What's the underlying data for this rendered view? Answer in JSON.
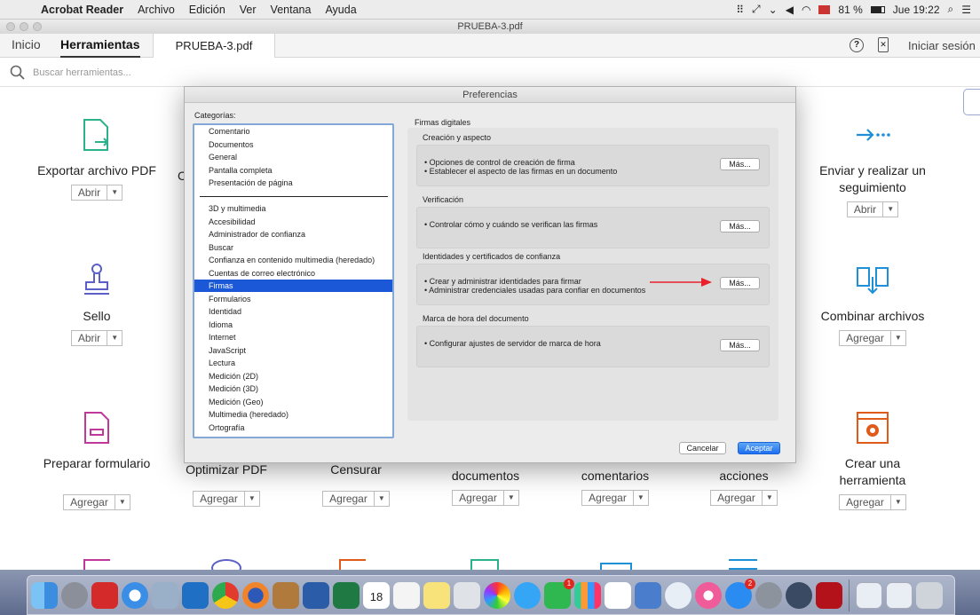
{
  "menubar": {
    "app": "Acrobat Reader",
    "items": [
      "Archivo",
      "Edición",
      "Ver",
      "Ventana",
      "Ayuda"
    ],
    "battery": "81 %",
    "clock": "Jue 19:22"
  },
  "window": {
    "title": "PRUEBA-3.pdf"
  },
  "tabs": {
    "home": "Inicio",
    "tools": "Herramientas",
    "document": "PRUEBA-3.pdf",
    "signin": "Iniciar sesión"
  },
  "search": {
    "placeholder": "Buscar herramientas..."
  },
  "tools": [
    {
      "label": "Exportar archivo PDF",
      "action": "Abrir"
    },
    {
      "label": "Enviar y realizar un seguimiento",
      "action": "Abrir"
    },
    {
      "label": "Sello",
      "action": "Abrir"
    },
    {
      "label": "Combinar archivos",
      "action": "Agregar"
    },
    {
      "label": "Preparar formulario",
      "action": "Agregar"
    },
    {
      "label": "Optimizar PDF",
      "action": "Agregar"
    },
    {
      "label": "Censurar",
      "action": "Agregar"
    },
    {
      "label": "documentos",
      "action": "Agregar"
    },
    {
      "label": "comentarios",
      "action": "Agregar"
    },
    {
      "label": "acciones",
      "action": "Agregar"
    },
    {
      "label": "Crear una herramienta",
      "action": "Agregar"
    }
  ],
  "partial_c": "C",
  "dialog": {
    "title": "Preferencias",
    "categories_label": "Categorías:",
    "categories_top": [
      "Comentario",
      "Documentos",
      "General",
      "Pantalla completa",
      "Presentación de página"
    ],
    "categories": [
      "3D y multimedia",
      "Accesibilidad",
      "Administrador de confianza",
      "Buscar",
      "Confianza en contenido multimedia (heredado)",
      "Cuentas de correo electrónico",
      "Firmas",
      "Formularios",
      "Identidad",
      "Idioma",
      "Internet",
      "JavaScript",
      "Lectura",
      "Medición (2D)",
      "Medición (3D)",
      "Medición (Geo)",
      "Multimedia (heredado)",
      "Ortografía"
    ],
    "selected": "Firmas",
    "panel_title": "Firmas digitales",
    "sections": [
      {
        "title": "Creación y aspecto",
        "lines": [
          "• Opciones de control de creación de firma",
          "• Establecer el aspecto de las firmas en un documento"
        ],
        "button": "Más..."
      },
      {
        "title": "Verificación",
        "lines": [
          "• Controlar cómo y cuándo se verifican las firmas"
        ],
        "button": "Más..."
      },
      {
        "title": "Identidades y certificados de confianza",
        "lines": [
          "• Crear y administrar identidades para firmar",
          "• Administrar credenciales usadas para confiar en documentos"
        ],
        "button": "Más..."
      },
      {
        "title": "Marca de hora del documento",
        "lines": [
          "• Configurar ajustes de servidor de marca de hora"
        ],
        "button": "Más..."
      }
    ],
    "cancel": "Cancelar",
    "accept": "Aceptar"
  },
  "dock": {
    "calendar_day": "18",
    "badge_facetime": "1",
    "badge_appstore": "2"
  },
  "colors": {
    "accent": "#1b58d8",
    "arrow": "#e8202a"
  }
}
